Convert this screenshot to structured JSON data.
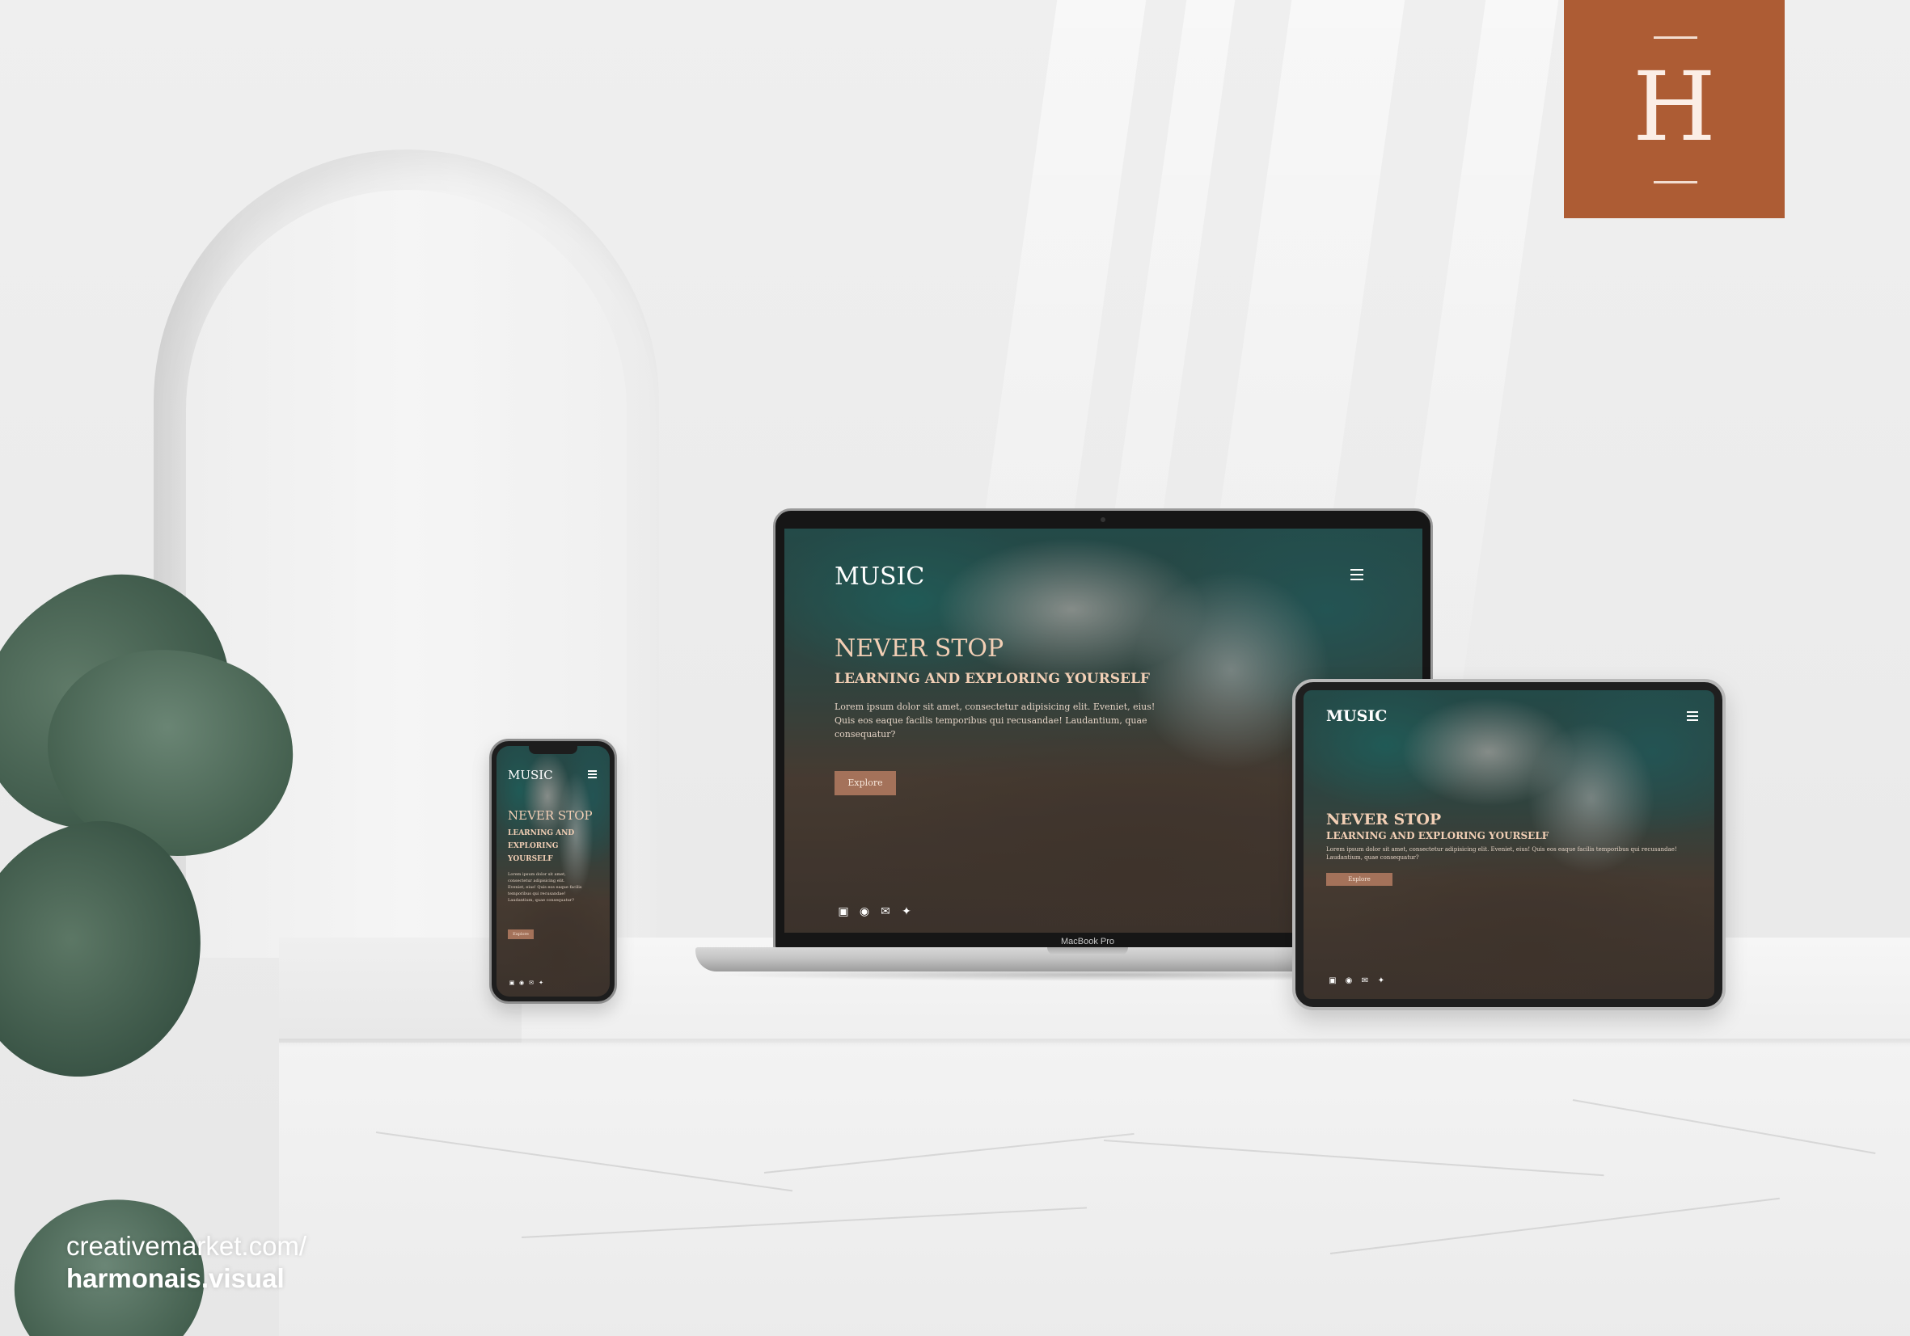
{
  "brand": {
    "letter": "H",
    "color": "#ad5c34"
  },
  "watermark": {
    "line1": "creativemarket.com/",
    "line2": "harmonais.visual"
  },
  "laptop": {
    "model_label": "MacBook Pro"
  },
  "website": {
    "logo": "MUSIC",
    "menu_icon": "hamburger-menu-icon",
    "heading": "NEVER STOP",
    "subheading": "LEARNING AND EXPLORING YOURSELF",
    "subheading_phone": [
      "LEARNING AND",
      "EXPLORING",
      "YOURSELF"
    ],
    "paragraph": "Lorem ipsum dolor sit amet, consectetur adipisicing elit. Eveniet, eius! Quis eos eaque facilis temporibus qui recusandae! Laudantium, quae consequatur?",
    "button_label": "Explore",
    "social_icons": [
      "facebook-icon",
      "instagram-icon",
      "email-icon",
      "twitter-icon"
    ],
    "accent": "#a4725a",
    "heading_color": "#f2cfb5"
  }
}
